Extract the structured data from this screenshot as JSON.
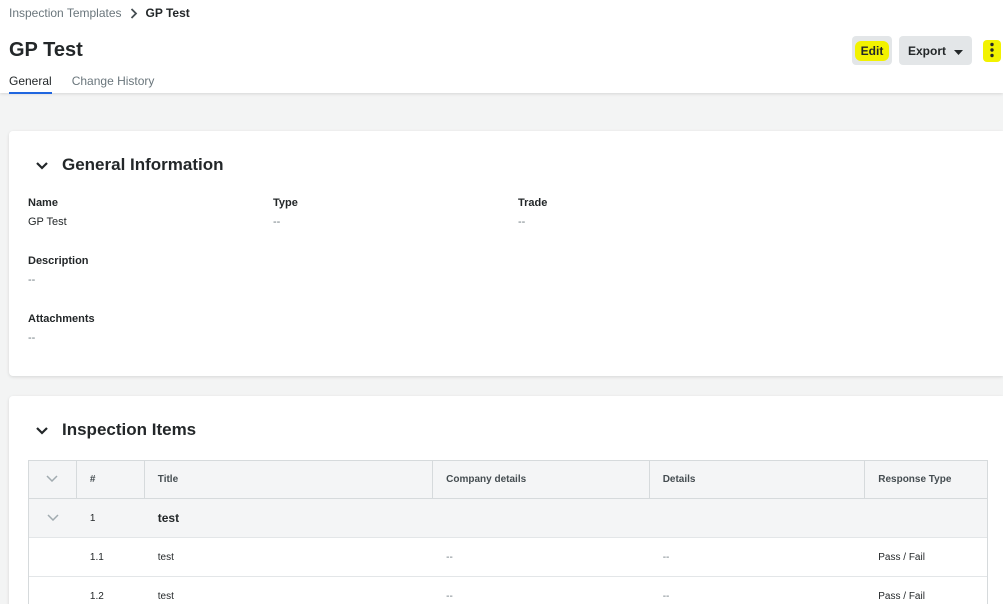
{
  "breadcrumb": {
    "parent": "Inspection Templates",
    "current": "GP Test"
  },
  "page": {
    "title": "GP Test"
  },
  "tabs": [
    {
      "label": "General",
      "active": true
    },
    {
      "label": "Change History",
      "active": false
    }
  ],
  "actions": {
    "edit": "Edit",
    "export": "Export"
  },
  "general": {
    "title": "General Information",
    "name_label": "Name",
    "name_value": "GP Test",
    "type_label": "Type",
    "type_value": "--",
    "trade_label": "Trade",
    "trade_value": "--",
    "description_label": "Description",
    "description_value": "--",
    "attachments_label": "Attachments",
    "attachments_value": "--"
  },
  "items": {
    "title": "Inspection Items",
    "columns": [
      "#",
      "Title",
      "Company details",
      "Details",
      "Response Type"
    ],
    "group": {
      "num": "1",
      "title": "test"
    },
    "rows": [
      {
        "num": "1.1",
        "title": "test",
        "company": "--",
        "details": "--",
        "response": "Pass / Fail"
      },
      {
        "num": "1.2",
        "title": "test",
        "company": "--",
        "details": "--",
        "response": "Pass / Fail"
      }
    ]
  },
  "colors": {
    "accent": "#2066df",
    "highlight": "#f2f200"
  }
}
